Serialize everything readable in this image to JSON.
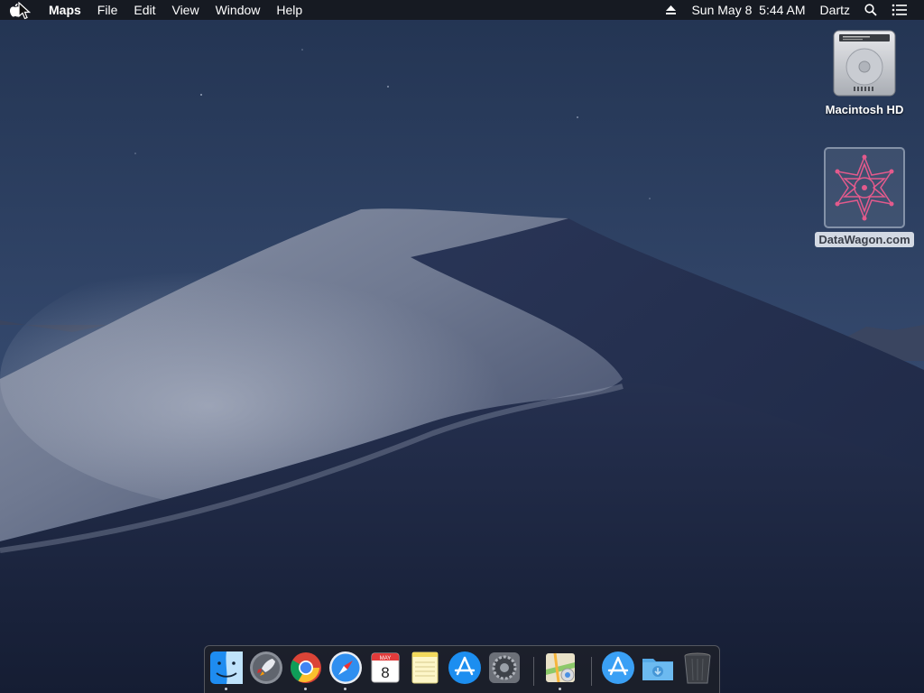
{
  "menubar": {
    "app_name": "Maps",
    "menus": [
      "File",
      "Edit",
      "View",
      "Window",
      "Help"
    ],
    "date_time": "Sun May 8  5:44 AM",
    "user": "Dartz"
  },
  "desktop": {
    "icons": [
      {
        "label": "Macintosh HD",
        "icon": "hard-drive-icon"
      },
      {
        "label": "DataWagon.com",
        "icon": "mandala-image-icon"
      }
    ]
  },
  "dock": {
    "calendar_month": "MAY",
    "calendar_day": "8",
    "apps": [
      {
        "name": "Finder",
        "icon": "finder-icon",
        "running": true
      },
      {
        "name": "Launchpad",
        "icon": "launchpad-icon",
        "running": false
      },
      {
        "name": "Google Chrome",
        "icon": "chrome-icon",
        "running": true
      },
      {
        "name": "Safari",
        "icon": "safari-icon",
        "running": true
      },
      {
        "name": "Calendar",
        "icon": "calendar-icon",
        "running": false
      },
      {
        "name": "Notes",
        "icon": "notes-icon",
        "running": false
      },
      {
        "name": "App Store",
        "icon": "app-store-icon",
        "running": false
      },
      {
        "name": "System Preferences",
        "icon": "system-preferences-icon",
        "running": false
      },
      {
        "name": "Maps",
        "icon": "maps-icon",
        "running": true
      },
      {
        "name": "Applications",
        "icon": "applications-folder-icon",
        "running": false
      },
      {
        "name": "Downloads",
        "icon": "downloads-folder-icon",
        "running": false
      },
      {
        "name": "Trash",
        "icon": "trash-icon",
        "running": false
      }
    ]
  },
  "colors": {
    "menubar_bg": "#16181e",
    "sky": "#2a3a5c",
    "dune_light": "#9aa3b8",
    "dune_dark": "#1f2a46"
  }
}
